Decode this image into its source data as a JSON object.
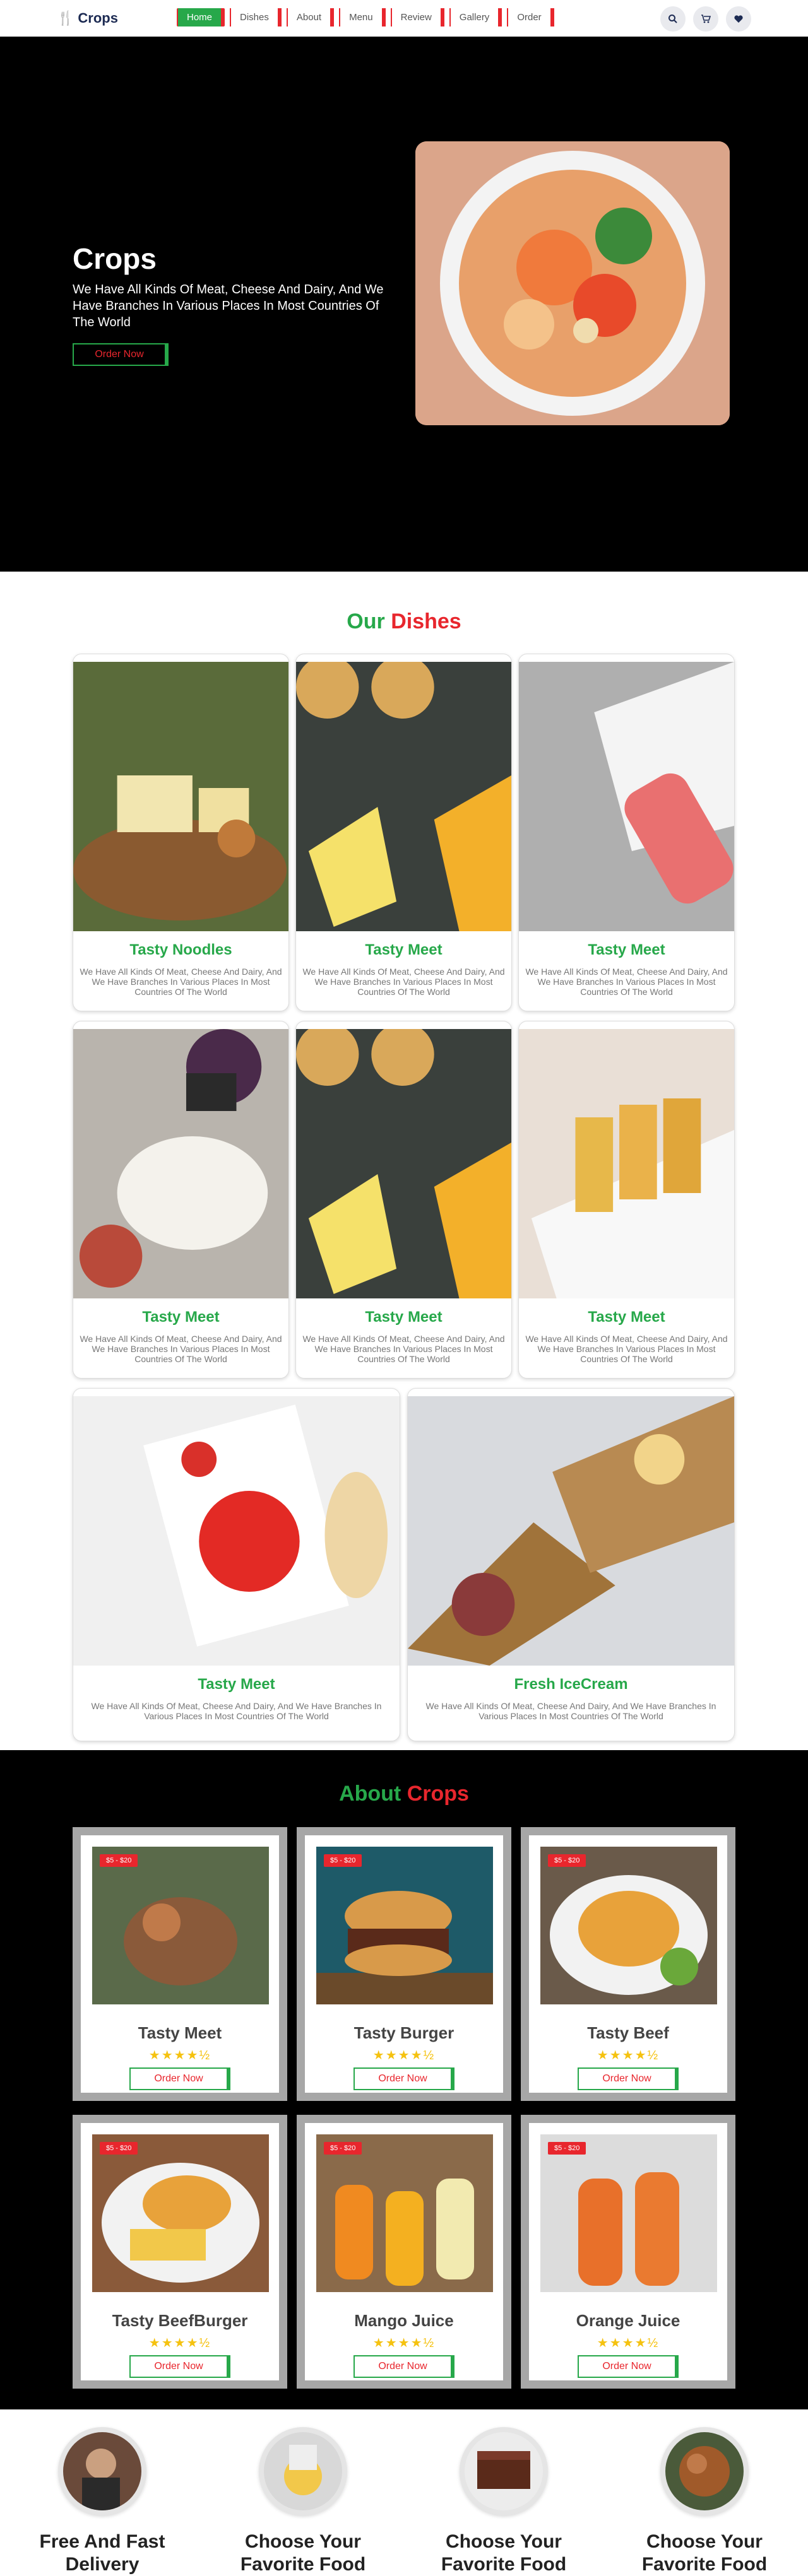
{
  "nav": {
    "brand": "Crops",
    "items": [
      "Home",
      "Dishes",
      "About",
      "Menu",
      "Review",
      "Gallery",
      "Order"
    ],
    "icons": [
      "search-icon",
      "cart-icon",
      "heart-icon"
    ]
  },
  "hero": {
    "title": "Crops",
    "subtitle": "We Have All Kinds Of Meat, Cheese And Dairy, And We Have Branches In Various Places In Most Countries Of The World",
    "button": "Order Now"
  },
  "dishes": {
    "title_a": "Our",
    "title_b": "Dishes",
    "cards": [
      {
        "title": "Tasty Noodles",
        "desc": "We Have All Kinds Of Meat, Cheese And Dairy, And We Have Branches In Various Places In Most Countries Of The World"
      },
      {
        "title": "Tasty Meet",
        "desc": "We Have All Kinds Of Meat, Cheese And Dairy, And We Have Branches In Various Places In Most Countries Of The World"
      },
      {
        "title": "Tasty Meet",
        "desc": "We Have All Kinds Of Meat, Cheese And Dairy, And We Have Branches In Various Places In Most Countries Of The World"
      },
      {
        "title": "Tasty Meet",
        "desc": "We Have All Kinds Of Meat, Cheese And Dairy, And We Have Branches In Various Places In Most Countries Of The World"
      },
      {
        "title": "Tasty Meet",
        "desc": "We Have All Kinds Of Meat, Cheese And Dairy, And We Have Branches In Various Places In Most Countries Of The World"
      },
      {
        "title": "Tasty Meet",
        "desc": "We Have All Kinds Of Meat, Cheese And Dairy, And We Have Branches In Various Places In Most Countries Of The World"
      },
      {
        "title": "Tasty Meet",
        "desc": "We Have All Kinds Of Meat, Cheese And Dairy, And We Have Branches In Various Places In Most Countries Of The World"
      },
      {
        "title": "Fresh IceCream",
        "desc": "We Have All Kinds Of Meat, Cheese And Dairy, And We Have Branches In Various Places In Most Countries Of The World"
      }
    ]
  },
  "about": {
    "title_a": "About",
    "title_b": "Crops",
    "products": [
      {
        "name": "Tasty Meet",
        "price": "$5 - $20",
        "stars": "★★★★½",
        "button": "Order Now"
      },
      {
        "name": "Tasty Burger",
        "price": "$5 - $20",
        "stars": "★★★★½",
        "button": "Order Now"
      },
      {
        "name": "Tasty Beef",
        "price": "$5 - $20",
        "stars": "★★★★½",
        "button": "Order Now"
      },
      {
        "name": "Tasty BeefBurger",
        "price": "$5 - $20",
        "stars": "★★★★½",
        "button": "Order Now"
      },
      {
        "name": "Mango Juice",
        "price": "$5 - $20",
        "stars": "★★★★½",
        "button": "Order Now"
      },
      {
        "name": "Orange Juice",
        "price": "$5 - $20",
        "stars": "★★★★½",
        "button": "Order Now"
      }
    ]
  },
  "features": [
    {
      "line1": "Free And Fast",
      "line2": "Delivery"
    },
    {
      "line1": "Choose Your",
      "line2": "Favorite Food"
    },
    {
      "line1": "Choose Your",
      "line2": "Favorite Food"
    },
    {
      "line1": "Choose Your",
      "line2": "Favorite Food"
    }
  ]
}
